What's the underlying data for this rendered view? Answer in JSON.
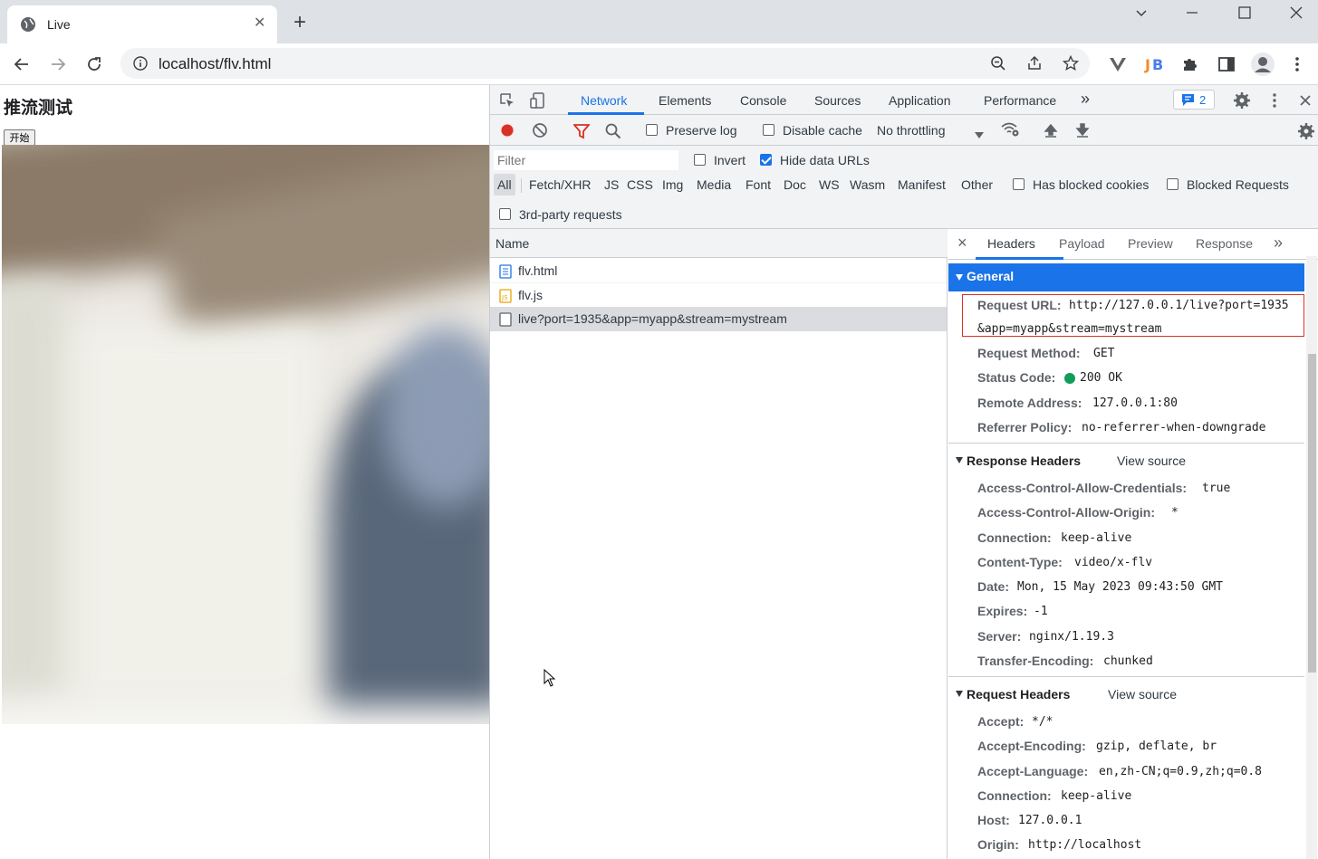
{
  "browser": {
    "tab_title": "Live",
    "new_tab": "+",
    "url": "localhost/flv.html"
  },
  "page": {
    "heading": "推流测试",
    "start_button": "开始"
  },
  "devtools": {
    "tabs": [
      "Network",
      "Elements",
      "Console",
      "Sources",
      "Application",
      "Performance"
    ],
    "active_tab": "Network",
    "more": "»",
    "issues_count": "2",
    "preserve_log": "Preserve log",
    "disable_cache": "Disable cache",
    "throttling": "No throttling",
    "filter_placeholder": "Filter",
    "invert": "Invert",
    "hide_data_urls": "Hide data URLs",
    "types": [
      "All",
      "Fetch/XHR",
      "JS",
      "CSS",
      "Img",
      "Media",
      "Font",
      "Doc",
      "WS",
      "Wasm",
      "Manifest",
      "Other"
    ],
    "has_blocked_cookies": "Has blocked cookies",
    "blocked_requests": "Blocked Requests",
    "third_party": "3rd-party requests",
    "name_header": "Name",
    "requests": [
      "flv.html",
      "flv.js",
      "live?port=1935&app=myapp&stream=mystream"
    ]
  },
  "detail": {
    "close": "×",
    "tabs": [
      "Headers",
      "Payload",
      "Preview",
      "Response"
    ],
    "more": "»",
    "general_title": "General",
    "general": {
      "request_url_k": "Request URL:",
      "request_url_v1": "http://127.0.0.1/live?port=1935",
      "request_url_v2": "&app=myapp&stream=mystream",
      "method_k": "Request Method:",
      "method_v": "GET",
      "status_k": "Status Code:",
      "status_v": "200 OK",
      "remote_k": "Remote Address:",
      "remote_v": "127.0.0.1:80",
      "referrer_k": "Referrer Policy:",
      "referrer_v": "no-referrer-when-downgrade"
    },
    "response_title": "Response Headers",
    "view_source": "View source",
    "response": [
      {
        "k": "Access-Control-Allow-Credentials:",
        "v": "true"
      },
      {
        "k": "Access-Control-Allow-Origin:",
        "v": "*"
      },
      {
        "k": "Connection:",
        "v": "keep-alive"
      },
      {
        "k": "Content-Type:",
        "v": "video/x-flv"
      },
      {
        "k": "Date:",
        "v": "Mon, 15 May 2023 09:43:50 GMT"
      },
      {
        "k": "Expires:",
        "v": "-1"
      },
      {
        "k": "Server:",
        "v": "nginx/1.19.3"
      },
      {
        "k": "Transfer-Encoding:",
        "v": "chunked"
      }
    ],
    "request_title": "Request Headers",
    "request": [
      {
        "k": "Accept:",
        "v": "*/*"
      },
      {
        "k": "Accept-Encoding:",
        "v": "gzip, deflate, br"
      },
      {
        "k": "Accept-Language:",
        "v": "en,zh-CN;q=0.9,zh;q=0.8"
      },
      {
        "k": "Connection:",
        "v": "keep-alive"
      },
      {
        "k": "Host:",
        "v": "127.0.0.1"
      },
      {
        "k": "Origin:",
        "v": "http://localhost"
      }
    ]
  },
  "colors": {
    "accent": "#1a73e8",
    "record": "#d93025",
    "status_ok": "#0f9d58",
    "highlight_border": "#d93025"
  }
}
